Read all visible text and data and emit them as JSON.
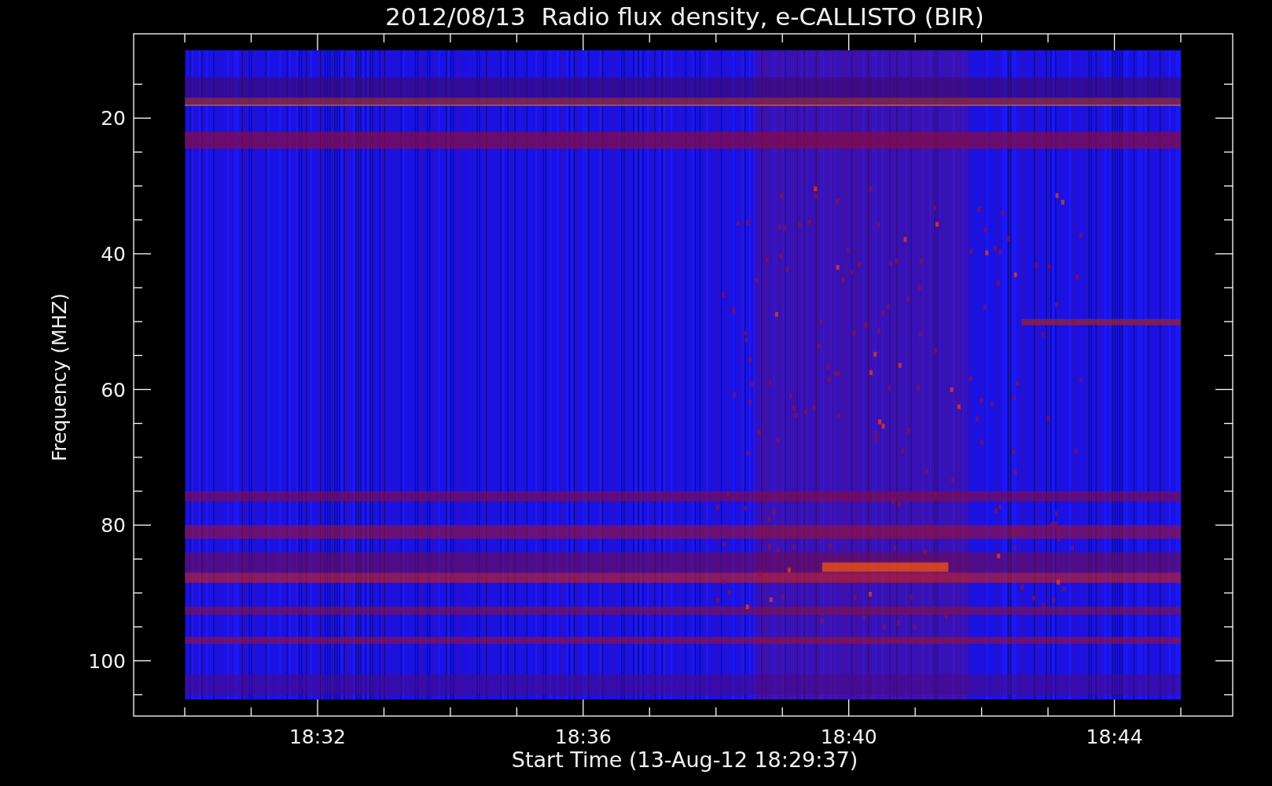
{
  "title": "2012/08/13  Radio flux density, e-CALLISTO (BIR)",
  "ylabel": "Frequency (MHZ)",
  "xlabel": "Start Time (13-Aug-12 18:29:37)",
  "yticks": [
    "20",
    "40",
    "60",
    "80",
    "100"
  ],
  "xticks": [
    "18:32",
    "18:36",
    "18:40",
    "18:44"
  ]
}
